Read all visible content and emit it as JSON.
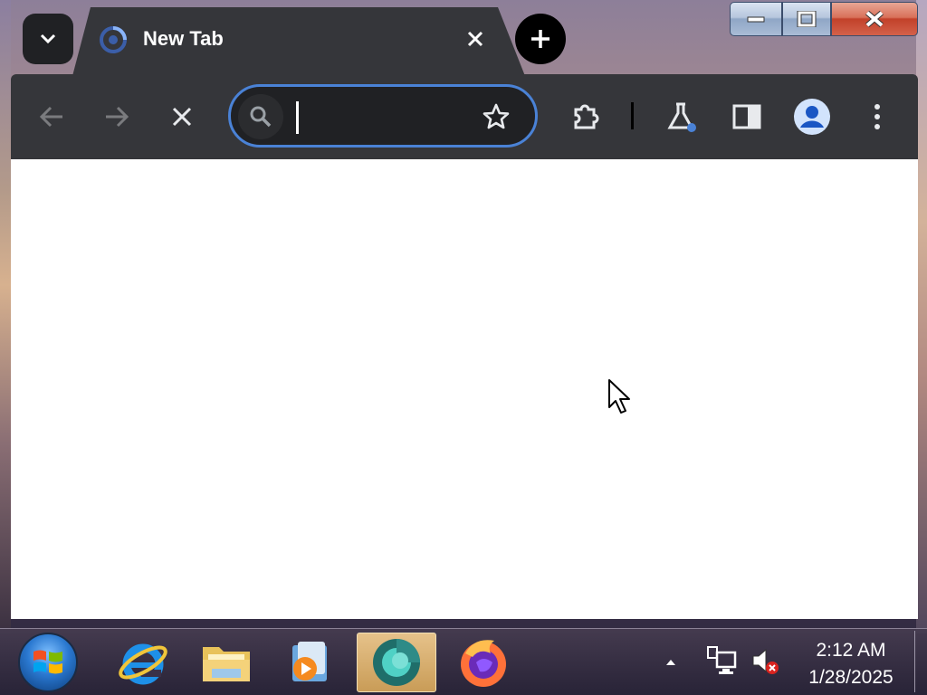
{
  "window": {
    "controls": {
      "minimize": "minimize",
      "maximize": "maximize",
      "close": "close"
    }
  },
  "tabs": [
    {
      "title": "New Tab",
      "favicon": "chrome-loading-icon",
      "active": true
    }
  ],
  "toolbar": {
    "back_icon": "arrow-left-icon",
    "forward_icon": "arrow-right-icon",
    "stop_icon": "close-icon",
    "omnibox": {
      "value": "",
      "placeholder": ""
    },
    "bookmark_icon": "star-icon",
    "extensions_icon": "puzzle-icon",
    "labs_icon": "flask-icon",
    "side_panel_icon": "side-panel-icon",
    "profile_icon": "profile-avatar-icon",
    "menu_icon": "kebab-menu-icon"
  },
  "colors": {
    "toolbar_bg": "#35363a",
    "omnibox_border": "#4a82d6",
    "tab_bg": "#35363a",
    "content_bg": "#ffffff"
  },
  "taskbar": {
    "start": "windows-start-orb",
    "apps": [
      {
        "name": "Internet Explorer",
        "icon": "ie-icon",
        "active": false
      },
      {
        "name": "File Explorer",
        "icon": "folder-icon",
        "active": false
      },
      {
        "name": "Media Player",
        "icon": "media-player-icon",
        "active": false
      },
      {
        "name": "Chrome Canary",
        "icon": "chrome-canary-icon",
        "active": true
      },
      {
        "name": "Firefox",
        "icon": "firefox-icon",
        "active": false
      }
    ],
    "tray": {
      "time": "2:12 AM",
      "date": "1/28/2025"
    }
  }
}
